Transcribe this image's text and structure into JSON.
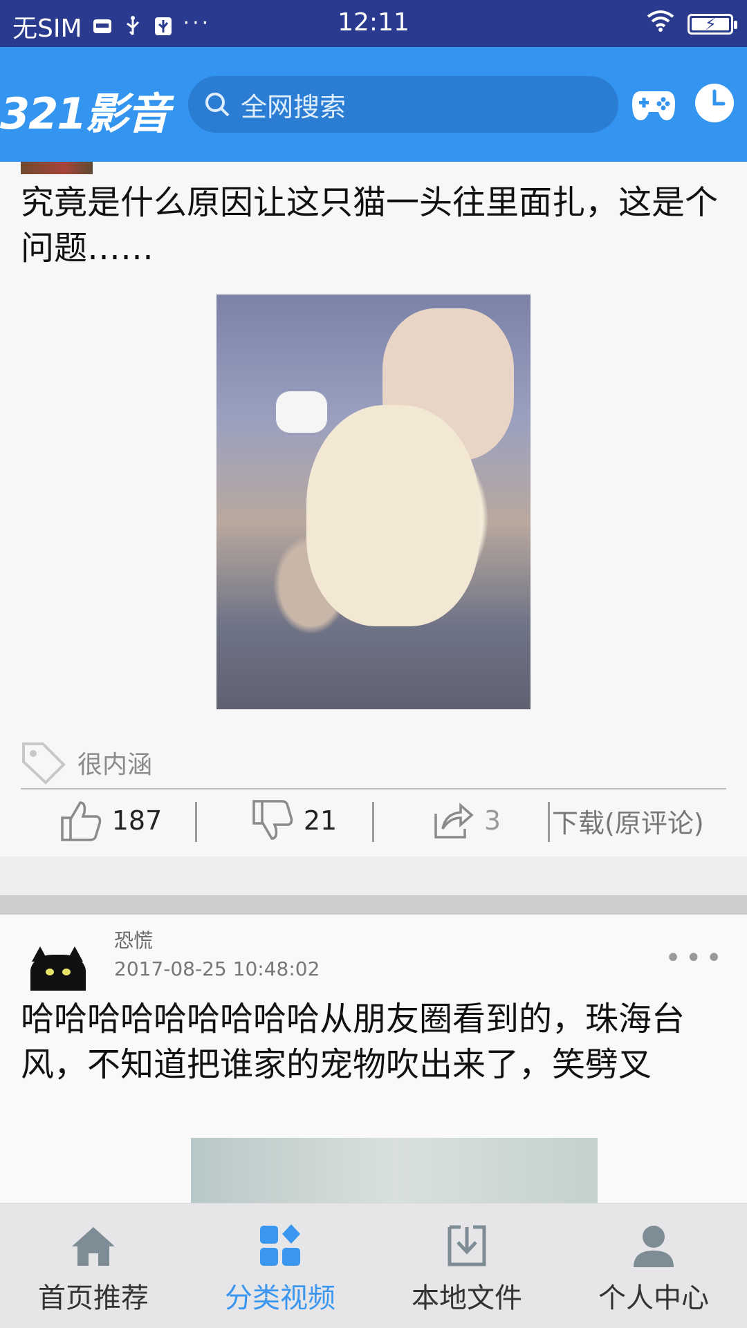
{
  "status_bar": {
    "carrier": "无SIM",
    "time": "12:11",
    "dots": "···"
  },
  "header": {
    "logo": "321影音",
    "search_placeholder": "全网搜索",
    "icons": [
      "gamepad-icon",
      "clock-icon"
    ]
  },
  "feed": {
    "post1": {
      "text": "究竟是什么原因让这只猫一头往里面扎，这是个问题……",
      "tag": "很内涵",
      "likes": "187",
      "dislikes": "21",
      "shares": "3",
      "download_label": "下载(原评论)"
    },
    "post2": {
      "author": "恐慌",
      "timestamp": "2017-08-25 10:48:02",
      "more": "•••",
      "text": "哈哈哈哈哈哈哈哈哈从朋友圈看到的，珠海台风，不知道把谁家的宠物吹出来了，笑劈叉"
    }
  },
  "bottom_nav": {
    "items": [
      {
        "label": "首页推荐",
        "icon": "home-icon",
        "active": false
      },
      {
        "label": "分类视频",
        "icon": "category-icon",
        "active": true
      },
      {
        "label": "本地文件",
        "icon": "download-icon",
        "active": false
      },
      {
        "label": "个人中心",
        "icon": "person-icon",
        "active": false
      }
    ]
  },
  "colors": {
    "status_bar": "#2a3a8f",
    "header": "#3495f0",
    "active_tab": "#3a96ef"
  }
}
